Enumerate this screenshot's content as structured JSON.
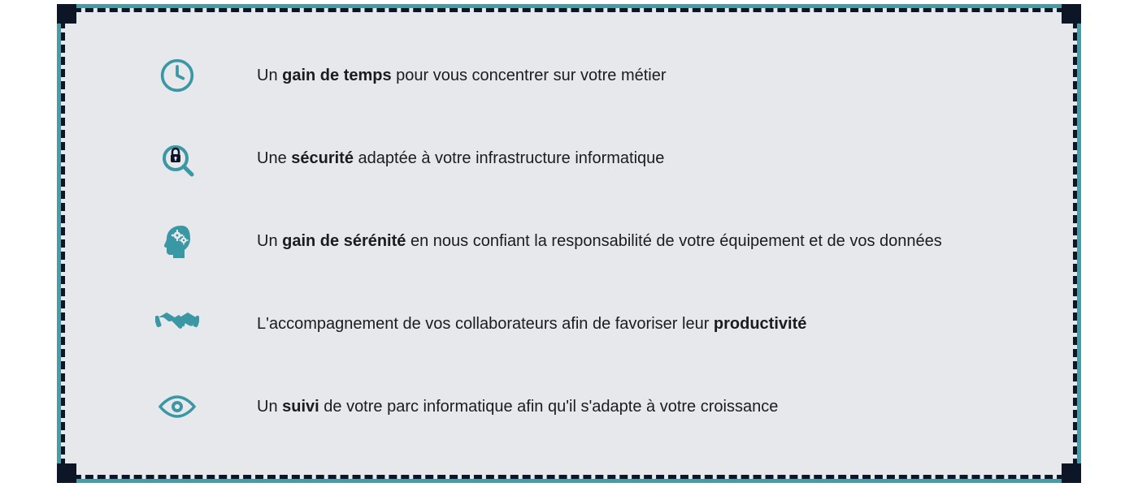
{
  "benefits": [
    {
      "icon": "clock-icon",
      "pre": "Un ",
      "bold": "gain de temps",
      "post": " pour vous concentrer sur votre métier"
    },
    {
      "icon": "security-magnifier-icon",
      "pre": "Une ",
      "bold": "sécurité",
      "post": " adaptée à votre infrastructure informatique"
    },
    {
      "icon": "head-gears-icon",
      "pre": "Un ",
      "bold": "gain de sérénité",
      "post": " en nous confiant la responsabilité de votre équipement et de vos données"
    },
    {
      "icon": "handshake-icon",
      "pre": "L'accompagnement de vos collaborateurs afin de favoriser leur ",
      "bold": "productivité",
      "post": ""
    },
    {
      "icon": "eye-icon",
      "pre": "Un ",
      "bold": "suivi",
      "post": " de votre parc informatique afin qu'il s'adapte à votre croissance"
    }
  ],
  "colors": {
    "accent": "#3a97a4",
    "frame": "#0c1626",
    "panel": "#e6e8ec"
  }
}
